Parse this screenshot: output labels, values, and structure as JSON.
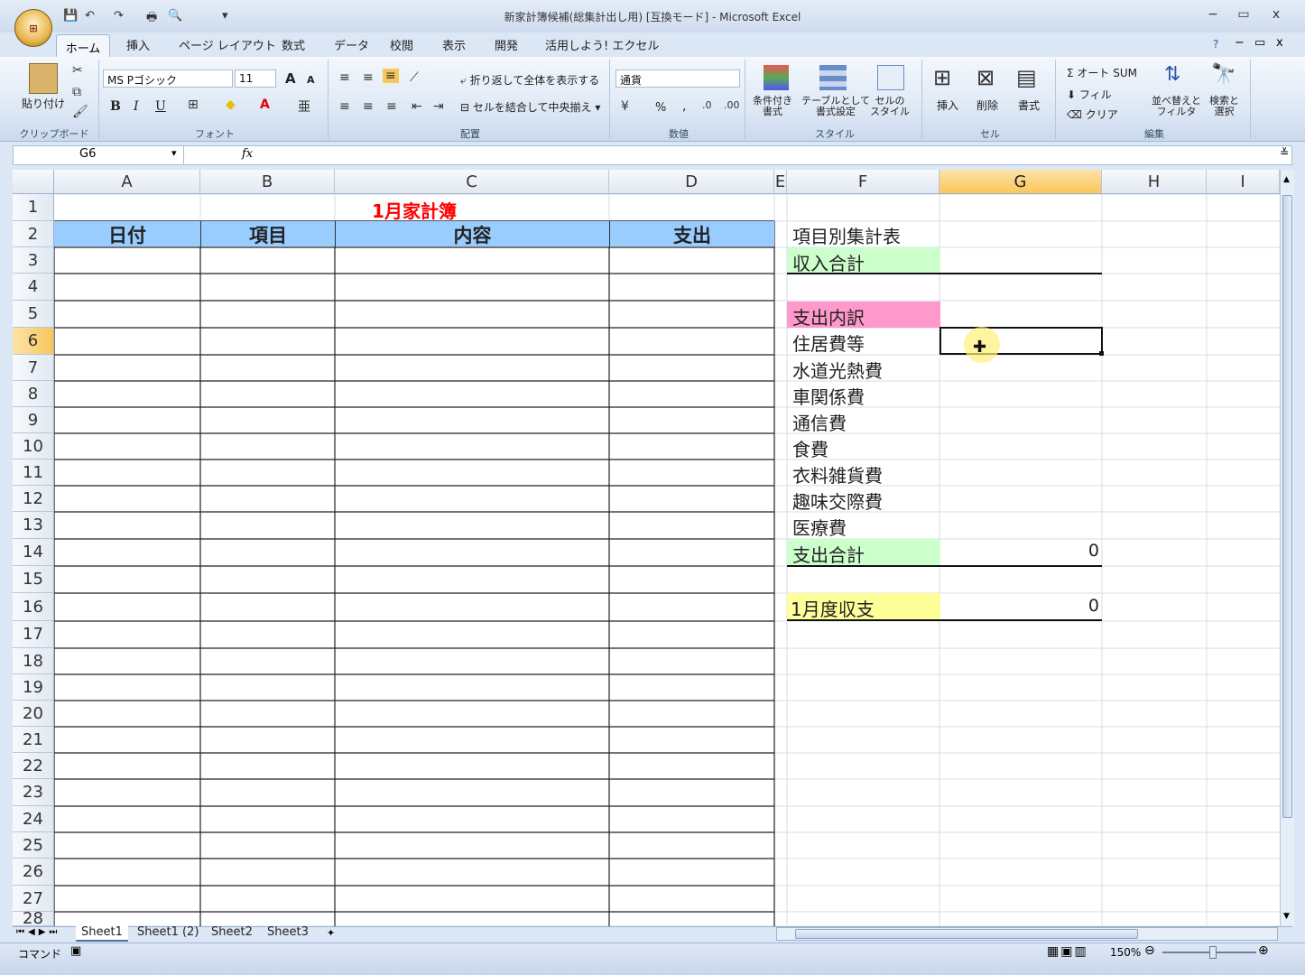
{
  "window": {
    "title": "新家計簿候補(総集計出し用) [互換モード] - Microsoft Excel",
    "minimize": "−",
    "restore": "▭",
    "close": "x",
    "ribbon_min": "−",
    "ribbon_restore": "▭",
    "ribbon_close": "x",
    "help": "?"
  },
  "office_button": "Office",
  "qat": {
    "save": "💾",
    "undo": "↶",
    "redo": "↷",
    "print": "🖶",
    "preview": "🔍",
    "more": "▾"
  },
  "tabs": [
    "ホーム",
    "挿入",
    "ページ レイアウト",
    "数式",
    "データ",
    "校閲",
    "表示",
    "開発",
    "活用しよう! エクセル"
  ],
  "ribbon": {
    "clipboard": {
      "label": "クリップボード",
      "paste": "貼り付け"
    },
    "font": {
      "label": "フォント",
      "name": "MS Pゴシック",
      "size": "11",
      "bold": "B",
      "italic": "I",
      "underline": "U",
      "grow": "A",
      "shrink": "A"
    },
    "alignment": {
      "label": "配置",
      "wrap": "折り返して全体を表示する",
      "merge": "セルを結合して中央揃え"
    },
    "number": {
      "label": "数値",
      "format": "通貨",
      "percent": "%",
      "comma": ","
    },
    "styles": {
      "label": "スタイル",
      "cond": "条件付き\n書式",
      "table": "テーブルとして\n書式設定",
      "cell": "セルの\nスタイル"
    },
    "cells": {
      "label": "セル",
      "insert": "挿入",
      "delete": "削除",
      "format": "書式"
    },
    "editing": {
      "label": "編集",
      "autosum": "Σ オート SUM",
      "fill": "フィル",
      "clear": "クリア",
      "sort": "並べ替えと\nフィルタ",
      "find": "検索と\n選択"
    }
  },
  "formula_bar": {
    "name": "G6",
    "fx": "fx",
    "value": ""
  },
  "columns": [
    "A",
    "B",
    "C",
    "D",
    "E",
    "F",
    "G",
    "H",
    "I"
  ],
  "rows": [
    "1",
    "2",
    "3",
    "4",
    "5",
    "6",
    "7",
    "8",
    "9",
    "10",
    "11",
    "12",
    "13",
    "14",
    "15",
    "16",
    "17",
    "18",
    "19",
    "20",
    "21",
    "22",
    "23",
    "24",
    "25",
    "26",
    "27",
    "28"
  ],
  "sheet": {
    "title": "1月家計簿",
    "headers": [
      "日付",
      "項目",
      "内容",
      "支出"
    ],
    "summary_title": "項目別集計表",
    "income_total": "収入合計",
    "breakdown": "支出内訳",
    "items": [
      "住居費等",
      "水道光熱費",
      "車関係費",
      "通信費",
      "食費",
      "衣料雑貨費",
      "趣味交際費",
      "医療費"
    ],
    "expense_total": "支出合計",
    "expense_total_value": "0",
    "balance": "1月度収支",
    "balance_value": "0"
  },
  "sheet_tabs": [
    "Sheet1",
    "Sheet1 (2)",
    "Sheet2",
    "Sheet3"
  ],
  "status": {
    "mode": "コマンド",
    "zoom": "150%"
  },
  "colors": {
    "header_fill": "#99ccff",
    "green": "#ccffcc",
    "pink": "#ff99cc",
    "yellow": "#ffff99",
    "title_red": "#ff0000"
  }
}
